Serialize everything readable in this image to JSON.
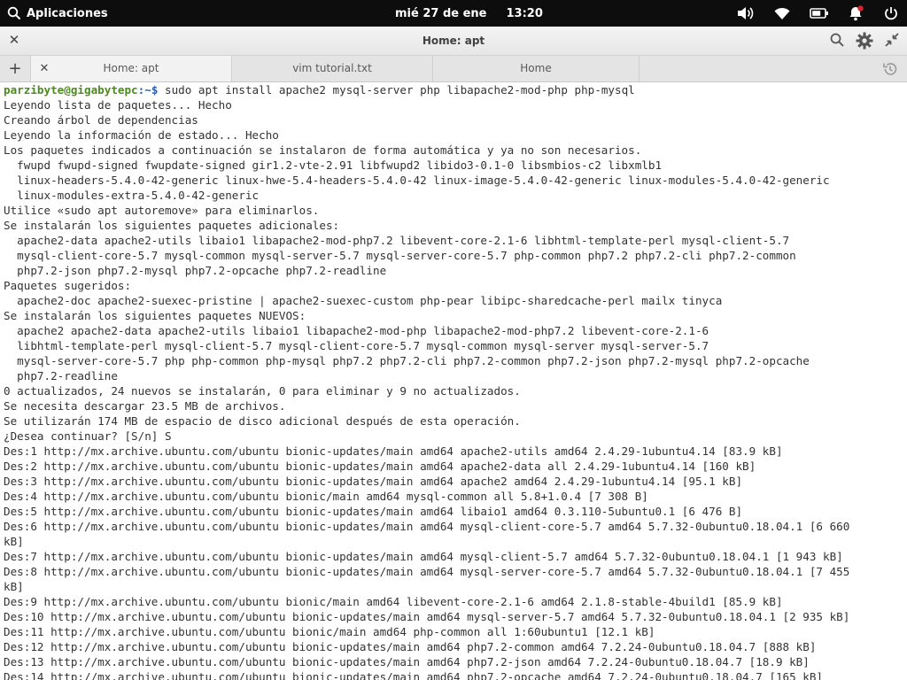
{
  "panel": {
    "apps_label": "Aplicaciones",
    "date": "mié 27 de ene",
    "time": "13:20",
    "icons": [
      "search-icon",
      "volume-icon",
      "wifi-icon",
      "battery-icon",
      "notification-bell-icon",
      "power-icon"
    ],
    "notification_color": "#d9222a"
  },
  "window": {
    "title": "Home: apt",
    "icons": [
      "close-icon",
      "search-icon",
      "gear-icon",
      "unmaximize-icon"
    ]
  },
  "tabs": [
    {
      "label": "Home: apt",
      "active": true
    },
    {
      "label": "vim tutorial.txt",
      "active": false
    },
    {
      "label": "Home",
      "active": false
    }
  ],
  "terminal": {
    "prompt_user": "parzibyte@gigabytepc",
    "prompt_path": ":~$",
    "command": " sudo apt install apache2 mysql-server php libapache2-mod-php php-mysql",
    "lines": [
      "Leyendo lista de paquetes... Hecho",
      "Creando árbol de dependencias",
      "Leyendo la información de estado... Hecho",
      "Los paquetes indicados a continuación se instalaron de forma automática y ya no son necesarios.",
      "  fwupd fwupd-signed fwupdate-signed gir1.2-vte-2.91 libfwupd2 libido3-0.1-0 libsmbios-c2 libxmlb1",
      "  linux-headers-5.4.0-42-generic linux-hwe-5.4-headers-5.4.0-42 linux-image-5.4.0-42-generic linux-modules-5.4.0-42-generic",
      "  linux-modules-extra-5.4.0-42-generic",
      "Utilice «sudo apt autoremove» para eliminarlos.",
      "Se instalarán los siguientes paquetes adicionales:",
      "  apache2-data apache2-utils libaio1 libapache2-mod-php7.2 libevent-core-2.1-6 libhtml-template-perl mysql-client-5.7",
      "  mysql-client-core-5.7 mysql-common mysql-server-5.7 mysql-server-core-5.7 php-common php7.2 php7.2-cli php7.2-common",
      "  php7.2-json php7.2-mysql php7.2-opcache php7.2-readline",
      "Paquetes sugeridos:",
      "  apache2-doc apache2-suexec-pristine | apache2-suexec-custom php-pear libipc-sharedcache-perl mailx tinyca",
      "Se instalarán los siguientes paquetes NUEVOS:",
      "  apache2 apache2-data apache2-utils libaio1 libapache2-mod-php libapache2-mod-php7.2 libevent-core-2.1-6",
      "  libhtml-template-perl mysql-client-5.7 mysql-client-core-5.7 mysql-common mysql-server mysql-server-5.7",
      "  mysql-server-core-5.7 php php-common php-mysql php7.2 php7.2-cli php7.2-common php7.2-json php7.2-mysql php7.2-opcache",
      "  php7.2-readline",
      "0 actualizados, 24 nuevos se instalarán, 0 para eliminar y 9 no actualizados.",
      "Se necesita descargar 23.5 MB de archivos.",
      "Se utilizarán 174 MB de espacio de disco adicional después de esta operación.",
      "¿Desea continuar? [S/n] S",
      "Des:1 http://mx.archive.ubuntu.com/ubuntu bionic-updates/main amd64 apache2-utils amd64 2.4.29-1ubuntu4.14 [83.9 kB]",
      "Des:2 http://mx.archive.ubuntu.com/ubuntu bionic-updates/main amd64 apache2-data all 2.4.29-1ubuntu4.14 [160 kB]",
      "Des:3 http://mx.archive.ubuntu.com/ubuntu bionic-updates/main amd64 apache2 amd64 2.4.29-1ubuntu4.14 [95.1 kB]",
      "Des:4 http://mx.archive.ubuntu.com/ubuntu bionic/main amd64 mysql-common all 5.8+1.0.4 [7 308 B]",
      "Des:5 http://mx.archive.ubuntu.com/ubuntu bionic-updates/main amd64 libaio1 amd64 0.3.110-5ubuntu0.1 [6 476 B]",
      "Des:6 http://mx.archive.ubuntu.com/ubuntu bionic-updates/main amd64 mysql-client-core-5.7 amd64 5.7.32-0ubuntu0.18.04.1 [6 660",
      "kB]",
      "Des:7 http://mx.archive.ubuntu.com/ubuntu bionic-updates/main amd64 mysql-client-5.7 amd64 5.7.32-0ubuntu0.18.04.1 [1 943 kB]",
      "Des:8 http://mx.archive.ubuntu.com/ubuntu bionic-updates/main amd64 mysql-server-core-5.7 amd64 5.7.32-0ubuntu0.18.04.1 [7 455",
      "kB]",
      "Des:9 http://mx.archive.ubuntu.com/ubuntu bionic/main amd64 libevent-core-2.1-6 amd64 2.1.8-stable-4build1 [85.9 kB]",
      "Des:10 http://mx.archive.ubuntu.com/ubuntu bionic-updates/main amd64 mysql-server-5.7 amd64 5.7.32-0ubuntu0.18.04.1 [2 935 kB]",
      "Des:11 http://mx.archive.ubuntu.com/ubuntu bionic/main amd64 php-common all 1:60ubuntu1 [12.1 kB]",
      "Des:12 http://mx.archive.ubuntu.com/ubuntu bionic-updates/main amd64 php7.2-common amd64 7.2.24-0ubuntu0.18.04.7 [888 kB]",
      "Des:13 http://mx.archive.ubuntu.com/ubuntu bionic-updates/main amd64 php7.2-json amd64 7.2.24-0ubuntu0.18.04.7 [18.9 kB]",
      "Des:14 http://mx.archive.ubuntu.com/ubuntu bionic-updates/main amd64 php7.2-opcache amd64 7.2.24-0ubuntu0.18.04.7 [165 kB]"
    ]
  }
}
